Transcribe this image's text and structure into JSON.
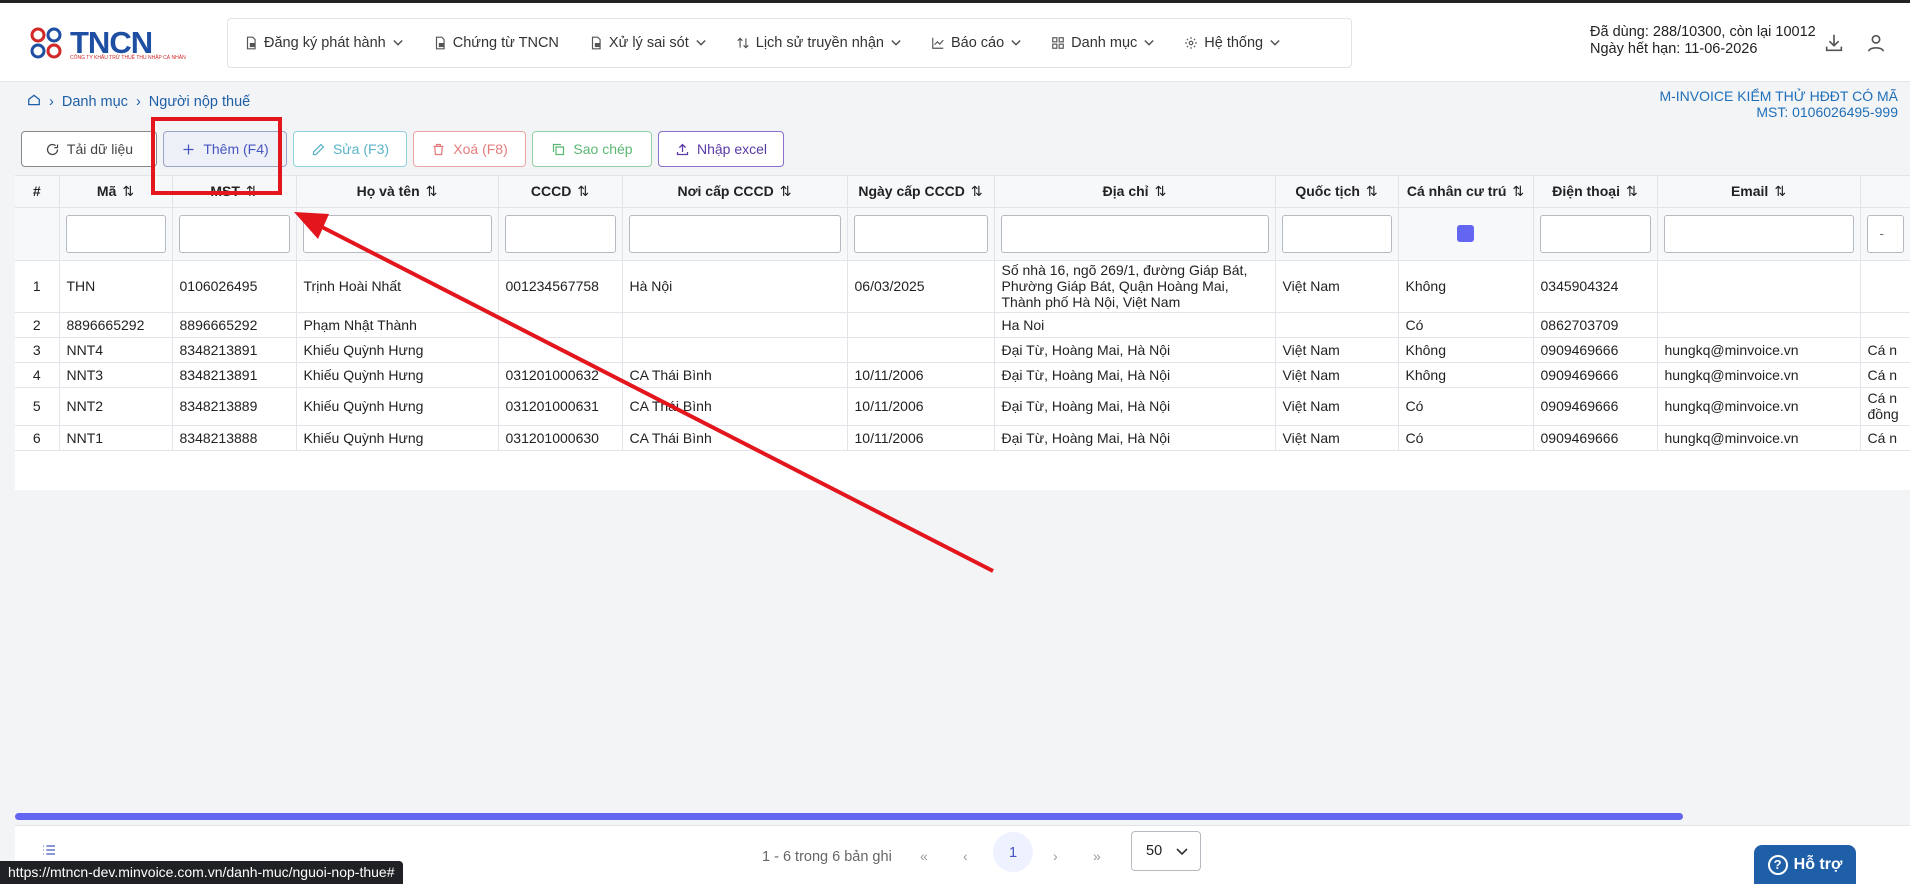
{
  "header": {
    "logo_text": "TNCN",
    "logo_sub": "CÔNG TY KHẤU TRỪ THUẾ THU NHẬP CÁ NHÂN",
    "nav": [
      {
        "label": "Đăng ký phát hành",
        "icon": "file-lock-icon",
        "has_dropdown": true
      },
      {
        "label": "Chứng từ TNCN",
        "icon": "file-lock-icon",
        "has_dropdown": false
      },
      {
        "label": "Xử lý sai sót",
        "icon": "file-lock-icon",
        "has_dropdown": true
      },
      {
        "label": "Lịch sử truyền nhận",
        "icon": "sort-arrows-icon",
        "has_dropdown": true
      },
      {
        "label": "Báo cáo",
        "icon": "chart-line-icon",
        "has_dropdown": true
      },
      {
        "label": "Danh mục",
        "icon": "grid-icon",
        "has_dropdown": true
      },
      {
        "label": "Hệ thống",
        "icon": "gear-icon",
        "has_dropdown": true
      }
    ],
    "quota_line1": "Đã dùng: 288/10300, còn lại 10012",
    "quota_line2": "Ngày hết hạn: 11-06-2026"
  },
  "breadcrumb": {
    "items": [
      "Danh mục",
      "Người nộp thuế"
    ]
  },
  "company": {
    "name": "M-INVOICE KIỂM THỬ HĐĐT CÓ MÃ",
    "tax_code": "MST: 0106026495-999"
  },
  "toolbar": {
    "reload": "Tải dữ liệu",
    "add": "Thêm (F4)",
    "edit": "Sửa (F3)",
    "delete": "Xoá (F8)",
    "copy": "Sao chép",
    "import": "Nhập excel"
  },
  "table": {
    "columns": [
      "#",
      "Mã",
      "MST",
      "Họ và tên",
      "CCCD",
      "Nơi cấp CCCD",
      "Ngày cấp CCCD",
      "Địa chỉ",
      "Quốc tịch",
      "Cá nhân cư trú",
      "Điện thoại",
      "Email",
      ""
    ],
    "filter_select": "-",
    "rows": [
      [
        "1",
        "THN",
        "0106026495",
        "Trịnh Hoài Nhất",
        "001234567758",
        "Hà Nội",
        "06/03/2025",
        "Số nhà 16, ngõ 269/1, đường Giáp Bát, Phường Giáp Bát, Quận Hoàng Mai, Thành phố Hà Nội, Việt Nam",
        "Việt Nam",
        "Không",
        "0345904324",
        "",
        ""
      ],
      [
        "2",
        "8896665292",
        "8896665292",
        "Phạm Nhật Thành",
        "",
        "",
        "",
        "Ha Noi",
        "",
        "Có",
        "0862703709",
        "",
        ""
      ],
      [
        "3",
        "NNT4",
        "8348213891",
        "Khiếu Quỳnh Hưng",
        "",
        "",
        "",
        "Đại Từ, Hoàng Mai, Hà Nội",
        "Việt Nam",
        "Không",
        "0909469666",
        "hungkq@minvoice.vn",
        "Cá n"
      ],
      [
        "4",
        "NNT3",
        "8348213891",
        "Khiếu Quỳnh Hưng",
        "031201000632",
        "CA Thái Bình",
        "10/11/2006",
        "Đại Từ, Hoàng Mai, Hà Nội",
        "Việt Nam",
        "Không",
        "0909469666",
        "hungkq@minvoice.vn",
        "Cá n"
      ],
      [
        "5",
        "NNT2",
        "8348213889",
        "Khiếu Quỳnh Hưng",
        "031201000631",
        "CA Thái Bình",
        "10/11/2006",
        "Đại Từ, Hoàng Mai, Hà Nội",
        "Việt Nam",
        "Có",
        "0909469666",
        "hungkq@minvoice.vn",
        "Cá n đồng"
      ],
      [
        "6",
        "NNT1",
        "8348213888",
        "Khiếu Quỳnh Hưng",
        "031201000630",
        "CA Thái Bình",
        "10/11/2006",
        "Đại Từ, Hoàng Mai, Hà Nội",
        "Việt Nam",
        "Có",
        "0909469666",
        "hungkq@minvoice.vn",
        "Cá n"
      ]
    ]
  },
  "pagination": {
    "info": "1 - 6 trong 6 bản ghi",
    "current": "1",
    "page_size": "50"
  },
  "support": {
    "label": "Hỗ trợ"
  },
  "status_url": "https://mtncn-dev.minvoice.com.vn/danh-muc/nguoi-nop-thue#",
  "colors": {
    "accent": "#6366f1",
    "brand": "#1f4fa3",
    "highlight": "#e3161e"
  }
}
